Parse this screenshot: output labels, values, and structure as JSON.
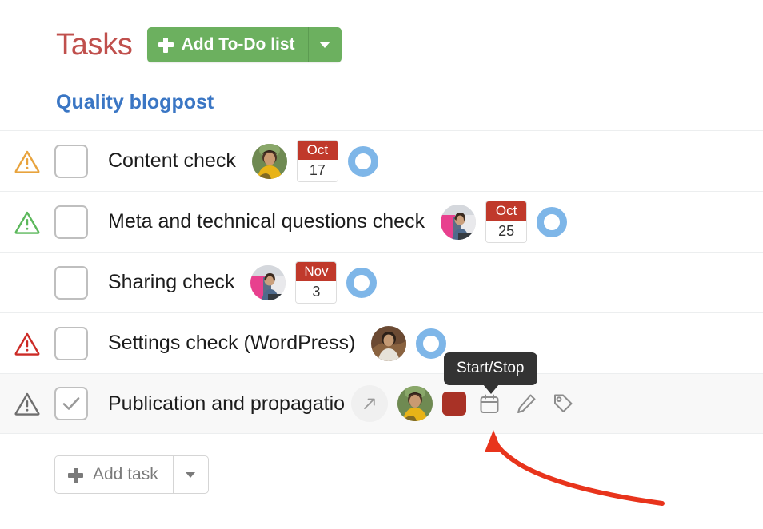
{
  "header": {
    "title": "Tasks",
    "add_list_button": {
      "label": "Add To-Do list",
      "icon": "plus-icon",
      "caret_icon": "chevron-down-icon",
      "color": "#6cb05f"
    },
    "list_link": {
      "label": "Quality blogpost",
      "color": "#3a76c4"
    },
    "title_color": "#c0504d"
  },
  "tooltip": {
    "text": "Start/Stop",
    "background": "#333333"
  },
  "tasks": [
    {
      "priority_icon": "warning-triangle-icon",
      "priority_color": "#e8a33d",
      "checked": false,
      "title": "Content check",
      "assignee_avatar": "user-avatar",
      "due_month": "Oct",
      "due_day": "17",
      "timer_icon": "timer-ring-icon",
      "timer_color": "#7eb6e8",
      "hovered": false
    },
    {
      "priority_icon": "warning-triangle-icon",
      "priority_color": "#5cb85c",
      "checked": false,
      "title": "Meta and technical questions check",
      "assignee_avatar": "user-avatar",
      "due_month": "Oct",
      "due_day": "25",
      "timer_icon": "timer-ring-icon",
      "timer_color": "#7eb6e8",
      "hovered": false
    },
    {
      "priority_icon": null,
      "priority_color": null,
      "checked": false,
      "title": "Sharing check",
      "assignee_avatar": "user-avatar",
      "due_month": "Nov",
      "due_day": "3",
      "timer_icon": "timer-ring-icon",
      "timer_color": "#7eb6e8",
      "hovered": false
    },
    {
      "priority_icon": "warning-triangle-icon",
      "priority_color": "#cc2b26",
      "checked": false,
      "title": "Settings check (WordPress)",
      "assignee_avatar": "user-avatar",
      "due_month": null,
      "due_day": null,
      "timer_icon": "timer-ring-icon",
      "timer_color": "#7eb6e8",
      "hovered": false
    },
    {
      "priority_icon": "warning-triangle-icon",
      "priority_color": "#6e6e6e",
      "checked": true,
      "title": "Publication and propagatio",
      "assignee_avatar": "user-avatar",
      "due_month": null,
      "due_day": null,
      "timer_icon": "stop-square-icon",
      "timer_color": "#a93226",
      "hovered": true,
      "actions": [
        {
          "name": "open-task-icon",
          "glyph": "↗"
        },
        {
          "name": "calendar-icon",
          "glyph": "calendar"
        },
        {
          "name": "edit-pencil-icon",
          "glyph": "pencil"
        },
        {
          "name": "tag-icon",
          "glyph": "tag"
        }
      ]
    }
  ],
  "footer": {
    "add_task_button": {
      "label": "Add task",
      "icon": "plus-icon",
      "caret_icon": "chevron-down-icon"
    }
  },
  "annotation": {
    "arrow_color": "#e8341c",
    "description": "curved arrow pointing at start-stop button"
  }
}
